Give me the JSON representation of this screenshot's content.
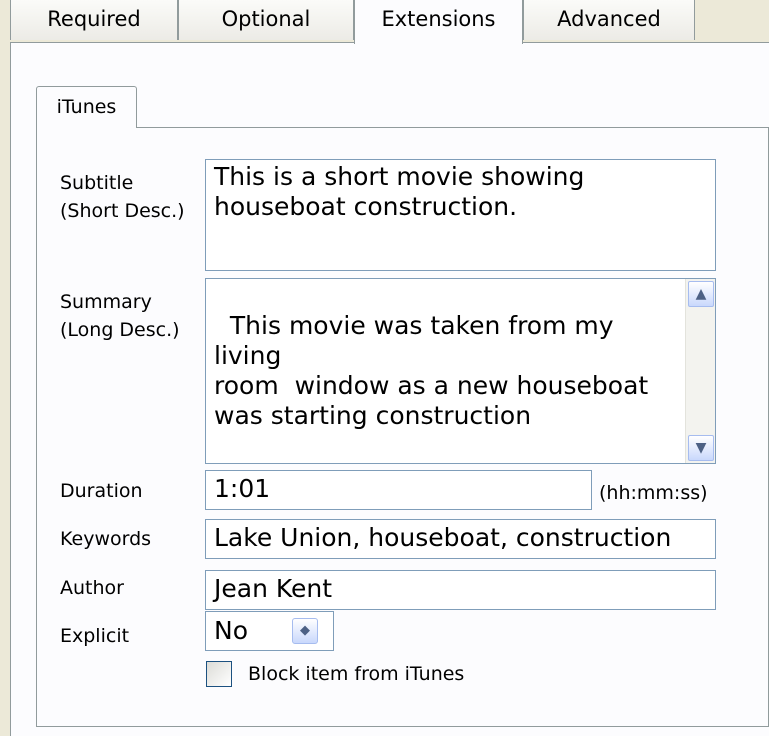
{
  "tabs": [
    "Required",
    "Optional",
    "Extensions",
    "Advanced"
  ],
  "active_tab": "Extensions",
  "inner_tab": "iTunes",
  "fields": {
    "subtitle": {
      "label_line1": "Subtitle",
      "label_line2": "(Short Desc.)",
      "value": "This is a short movie showing\nhouseboat construction."
    },
    "summary": {
      "label_line1": "Summary",
      "label_line2": "(Long Desc.)",
      "value": "This movie was taken from my living\nroom  window as a new houseboat\nwas starting construction"
    },
    "duration": {
      "label": "Duration",
      "value": "1:01",
      "hint": "(hh:mm:ss)"
    },
    "keywords": {
      "label": "Keywords",
      "value": "Lake Union, houseboat, construction"
    },
    "author": {
      "label": "Author",
      "value": "Jean Kent"
    },
    "explicit": {
      "label": "Explicit",
      "value": "No"
    },
    "block": {
      "label": "Block item from iTunes",
      "checked": false
    }
  },
  "colors": {
    "background": "#ece9d8",
    "panel": "#fcfcfe",
    "border": "#919b9c",
    "input_border": "#7f9db9"
  },
  "icons": {
    "scroll_up": "chevron-up-icon",
    "scroll_down": "chevron-down-icon",
    "spinner": "up-down-icon"
  }
}
